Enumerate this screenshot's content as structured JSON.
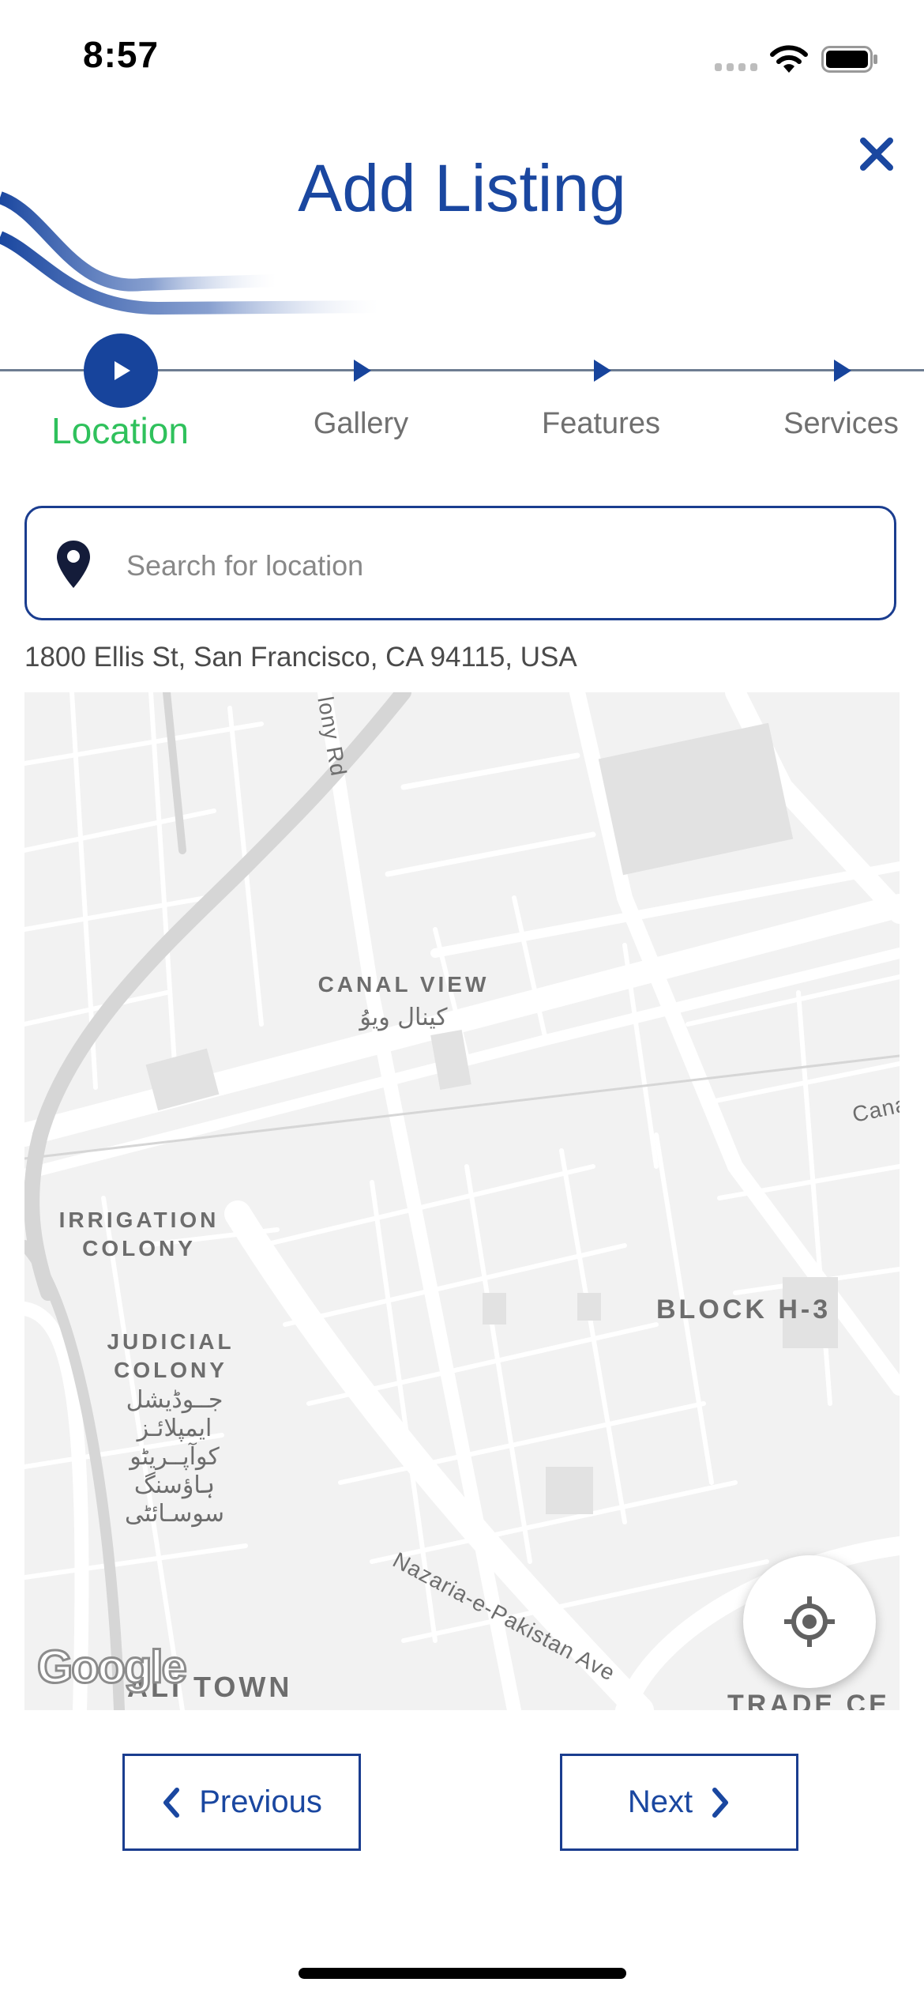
{
  "status_bar": {
    "time": "8:57"
  },
  "header": {
    "title": "Add Listing",
    "close_icon": "close-icon"
  },
  "stepper": {
    "steps": [
      {
        "label": "Location",
        "active": true
      },
      {
        "label": "Gallery",
        "active": false
      },
      {
        "label": "Features",
        "active": false
      },
      {
        "label": "Services",
        "active": false
      }
    ]
  },
  "search": {
    "placeholder": "Search for location",
    "value": ""
  },
  "address": "1800 Ellis St, San Francisco, CA 94115, USA",
  "map": {
    "labels": {
      "canal_view": "CANAL VIEW",
      "canal_view_urdu": "کینال ویوُ",
      "irrigation_1": "IRRIGATION",
      "irrigation_2": "COLONY",
      "judicial_1": "JUDICIAL",
      "judicial_2": "COLONY",
      "judicial_urdu_1": "جــوڈیشل",
      "judicial_urdu_2": "ایمپلائـز",
      "judicial_urdu_3": "کوآپــریٹو",
      "judicial_urdu_4": "ہاؤسنگ",
      "judicial_urdu_5": "سوسـائٹی",
      "block_h3": "BLOCK H-3",
      "canal_road": "Cana",
      "colony_rd": "lony Rd",
      "nazaria": "Nazaria-e-Pakistan Ave",
      "ali_town": "ALI TOWN",
      "trade": "TRADE CE"
    },
    "attribution": "Google"
  },
  "buttons": {
    "previous": "Previous",
    "next": "Next"
  },
  "colors": {
    "primary": "#1a47a0",
    "active_step": "#2fc15c",
    "border": "#1a3d8f"
  }
}
